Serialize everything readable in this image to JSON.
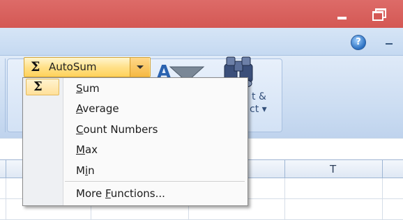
{
  "ribbon": {
    "autosum": {
      "symbol": "Σ",
      "label": "AutoSum"
    },
    "find_select": {
      "line1": "t &",
      "line2": "ct ▾"
    }
  },
  "help_icon": "?",
  "columns": {
    "visible_header": "T"
  },
  "autosum_menu": {
    "symbol": "Σ",
    "items": [
      {
        "label": "Sum",
        "access_key": "S"
      },
      {
        "label": "Average",
        "access_key": "A"
      },
      {
        "label": "Count Numbers",
        "access_key": "C"
      },
      {
        "label": "Max",
        "access_key": "M"
      },
      {
        "label": "Min",
        "access_key": "i"
      },
      {
        "label": "More Functions...",
        "access_key": "F"
      }
    ]
  },
  "colors": {
    "titlebar": "#d55955",
    "ribbon": "#c9dbf1",
    "autosum_highlight": "#ffd25a"
  }
}
